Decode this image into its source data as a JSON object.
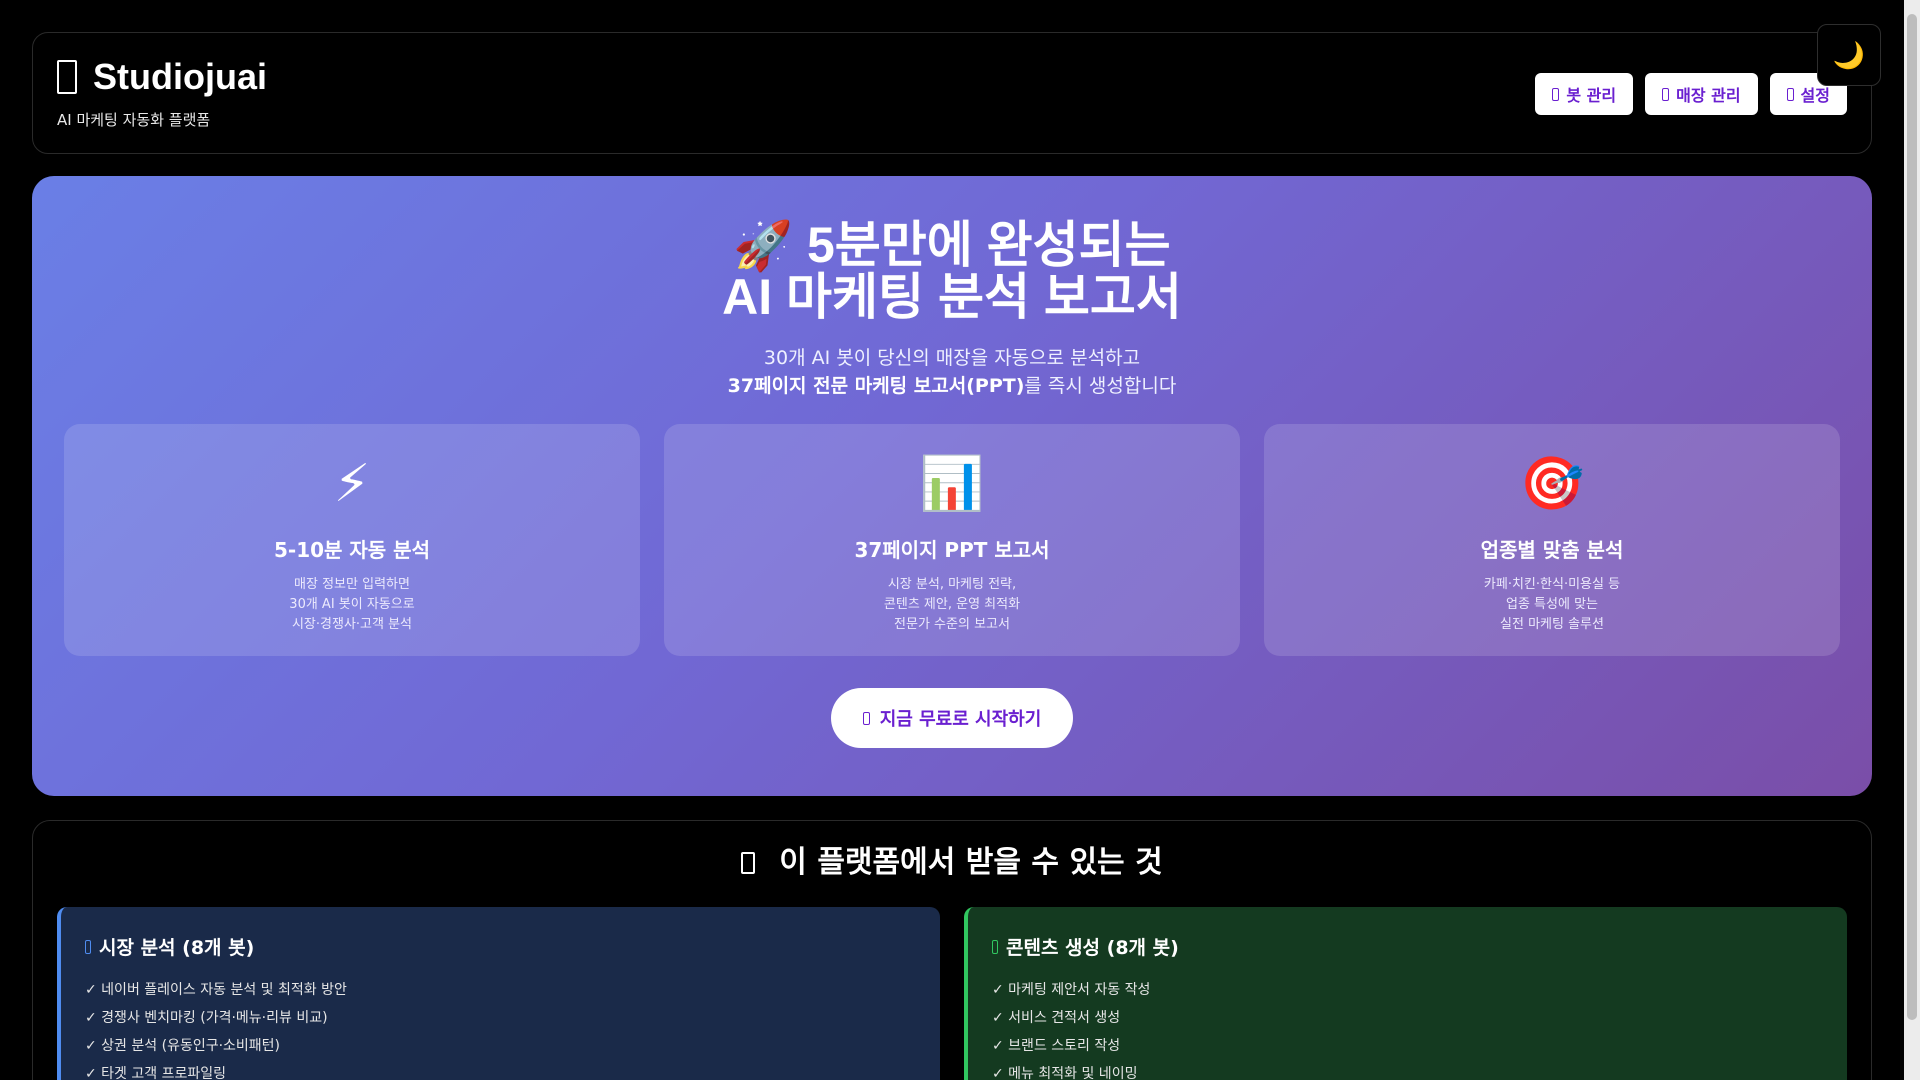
{
  "header": {
    "title": "Studiojuai",
    "subtitle": "AI 마케팅 자동화 플랫폼",
    "nav": [
      {
        "label": "봇 관리"
      },
      {
        "label": "매장 관리"
      },
      {
        "label": "설정"
      }
    ],
    "theme_toggle_icon": "🌙"
  },
  "hero": {
    "rocket": "🚀",
    "title_line1": "5분만에 완성되는",
    "title_line2": "AI 마케팅 분석 보고서",
    "sub_line1": "30개 AI 봇이 당신의 매장을 자동으로 분석하고",
    "sub_line2_bold": "37페이지 전문 마케팅 보고서(PPT)",
    "sub_line2_rest": "를 즉시 생성합니다",
    "features": [
      {
        "icon": "⚡",
        "title": "5-10분 자동 분석",
        "desc": "매장 정보만 입력하면\n30개 AI 봇이 자동으로\n시장·경쟁사·고객 분석"
      },
      {
        "icon": "📊",
        "title": "37페이지 PPT 보고서",
        "desc": "시장 분석, 마케팅 전략,\n콘텐츠 제안, 운영 최적화\n전문가 수준의 보고서"
      },
      {
        "icon": "🎯",
        "title": "업종별 맞춤 분석",
        "desc": "카페·치킨·한식·미용실 등\n업종 특성에 맞는\n실전 마케팅 솔루션"
      }
    ],
    "cta_label": "지금 무료로 시작하기"
  },
  "benefits": {
    "title": "이 플랫폼에서 받을 수 있는 것",
    "columns": [
      {
        "title": "시장 분석 (8개 봇)",
        "accent": "#4f8cf0",
        "items": [
          "✓ 네이버 플레이스 자동 분석 및 최적화 방안",
          "✓ 경쟁사 벤치마킹 (가격·메뉴·리뷰 비교)",
          "✓ 상권 분석 (유동인구·소비패턴)",
          "✓ 타겟 고객 프로파일링"
        ]
      },
      {
        "title": "콘텐츠 생성 (8개 봇)",
        "accent": "#31c760",
        "items": [
          "✓ 마케팅 제안서 자동 작성",
          "✓ 서비스 견적서 생성",
          "✓ 브랜드 스토리 작성",
          "✓ 메뉴 최적화 및 네이밍"
        ]
      }
    ]
  }
}
